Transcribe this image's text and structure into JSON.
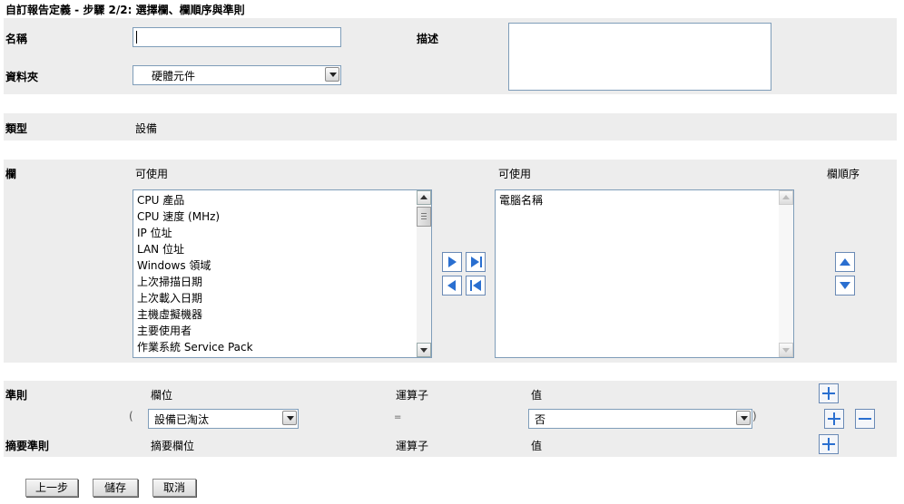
{
  "page_title": "自訂報告定義 - 步驟 2/2: 選擇欄、欄順序與準則",
  "form": {
    "name_label": "名稱",
    "name_value": "",
    "description_label": "描述",
    "description_value": "",
    "folder_label": "資料夾",
    "folder_selected": "硬體元件"
  },
  "type_row": {
    "label": "類型",
    "value": "設備"
  },
  "columns": {
    "label": "欄",
    "available_header": "可使用",
    "selected_header": "可使用",
    "order_header": "欄順序",
    "available_items": [
      "CPU 產品",
      "CPU 速度 (MHz)",
      "IP 位址",
      "LAN 位址",
      "Windows 領域",
      "上次掃描日期",
      "上次載入日期",
      "主機虛擬機器",
      "主要使用者",
      "作業系統 Service Pack"
    ],
    "selected_items": [
      "電腦名稱"
    ]
  },
  "criteria": {
    "label": "準則",
    "field_header": "欄位",
    "operator_header": "運算子",
    "value_header": "值",
    "open_paren": "(",
    "close_paren": ")",
    "field_selected": "設備已淘汰",
    "operator": "=",
    "value_selected": "否"
  },
  "summary_criteria": {
    "label": "摘要準則",
    "field_header": "摘要欄位",
    "operator_header": "運算子",
    "value_header": "值"
  },
  "buttons": {
    "back": "上一步",
    "save": "儲存",
    "cancel": "取消"
  },
  "colors": {
    "band": "#ededed",
    "icon_blue": "#2a6fd0"
  }
}
